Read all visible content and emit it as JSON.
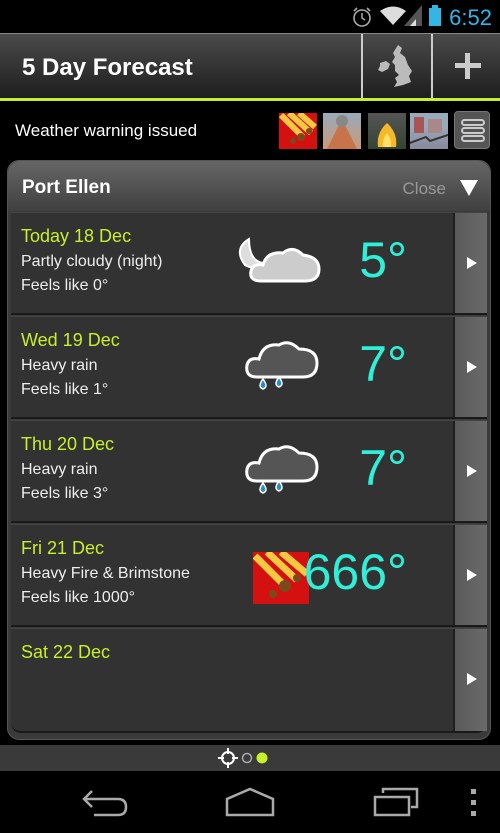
{
  "status_bar": {
    "time": "6:52",
    "icons": [
      "alarm-icon",
      "wifi-icon",
      "signal-icon",
      "battery-icon"
    ]
  },
  "action_bar": {
    "title": "5 Day Forecast",
    "buttons": [
      {
        "icon": "uk-map-icon",
        "label": "Map"
      },
      {
        "icon": "plus-icon",
        "label": "Add"
      }
    ]
  },
  "warning": {
    "text": "Weather warning issued",
    "thumbnails": [
      "fire-brimstone-icon",
      "volcano-icon",
      "fire-icon",
      "earthquake-icon"
    ],
    "menu_icon": "menu-icon"
  },
  "location": {
    "name": "Port Ellen",
    "close_label": "Close"
  },
  "forecast": [
    {
      "date": "Today 18 Dec",
      "description": "Partly cloudy (night)",
      "feels_like": "Feels like 0°",
      "temp": "5°",
      "icon": "partly-cloudy-night-icon"
    },
    {
      "date": "Wed 19 Dec",
      "description": "Heavy rain",
      "feels_like": "Feels like 1°",
      "temp": "7°",
      "icon": "heavy-rain-icon"
    },
    {
      "date": "Thu 20 Dec",
      "description": "Heavy rain",
      "feels_like": "Feels like 3°",
      "temp": "7°",
      "icon": "heavy-rain-icon"
    },
    {
      "date": "Fri 21 Dec",
      "description": "Heavy Fire & Brimstone",
      "feels_like": "Feels like 1000°",
      "temp": "666°",
      "icon": "fire-brimstone-icon"
    },
    {
      "date": "Sat 22 Dec",
      "description": "",
      "feels_like": "",
      "temp": "",
      "icon": ""
    }
  ],
  "pager": {
    "pages": 3,
    "current": 3,
    "first_icon": "locate-icon"
  },
  "colors": {
    "accent": "#c6f02a",
    "temp": "#2ef0d8",
    "clock": "#33b5e5"
  }
}
